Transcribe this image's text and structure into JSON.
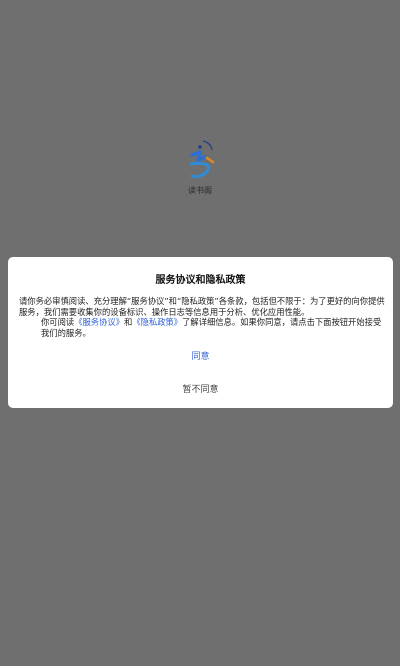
{
  "app": {
    "name": "读书阁",
    "logo_icon": "app-logo-icon"
  },
  "dialog": {
    "title": "服务协议和隐私政策",
    "paragraph1": "请你务必审慎阅读、充分理解“服务协议”和“隐私政策”各条款，包括但不限于：为了更好的向你提供服务，我们需要收集你的设备标识、操作日志等信息用于分析、优化应用性能。",
    "paragraph2_prefix": "你可阅读",
    "service_link": "《服务协议》",
    "paragraph2_and": "和",
    "privacy_link": "《隐私政策》",
    "paragraph2_suffix": "了解详细信息。如果你同意，请点击下面按钮开始接受我们的服务。",
    "agree_label": "同意",
    "disagree_label": "暂不同意"
  },
  "colors": {
    "overlay": "#6f6f6f",
    "dialog_bg": "#ffffff",
    "link": "#2b5fd9"
  }
}
